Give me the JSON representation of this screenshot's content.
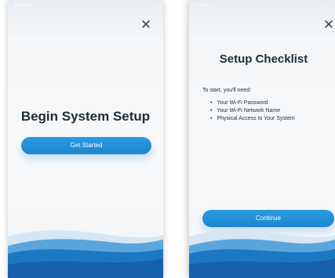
{
  "screen_left": {
    "title": "Begin System Setup",
    "primary_button": "Get Started",
    "close_icon": "close-icon"
  },
  "screen_right": {
    "title": "Setup Checklist",
    "intro": "To start, you'll need:",
    "items": [
      "Your Wi-Fi Password",
      "Your Wi-Fi Network Name",
      "Physical Access to Your System"
    ],
    "primary_button": "Continue",
    "close_icon": "close-icon"
  },
  "colors": {
    "accent": "#1c86cf",
    "title": "#1c2d3a",
    "wave_dark": "#1666b0",
    "wave_mid": "#2a86cd",
    "wave_light": "#bdd9ee"
  }
}
